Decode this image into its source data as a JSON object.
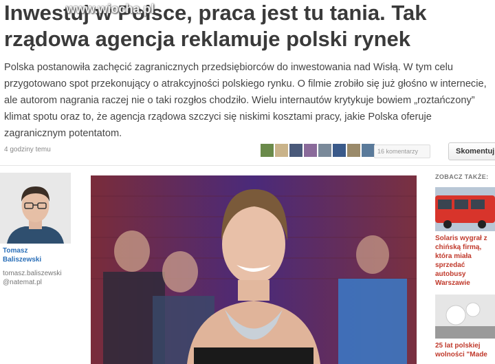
{
  "article": {
    "title_line1": "Inwestuj w Polsce, praca jest tu tania. Tak",
    "title_line2": "rządowa agencja reklamuje polski rynek",
    "watermark": "www.wiocha.pl",
    "lead": "Polska postanowiła zachęcić zagranicznych przedsiębiorców do inwestowania nad Wisłą. W tym celu przygotowano spot przekonujący o atrakcyjności polskiego rynku. O filmie zrobiło się już głośno w internecie, ale autorom nagrania raczej nie o taki rozgłos chodziło. Wielu internautów krytykuje bowiem „roztańczony” klimat spotu oraz to, że agencja rządowa szczyci się niskimi kosztami pracy, jakie Polska oferuje zagranicznym potentatom.",
    "timestamp": "4 godziny temu",
    "comments": "16 komentarzy",
    "comment_button": "Skomentuj"
  },
  "author": {
    "name_line1": "Tomasz",
    "name_line2": "Baliszewski",
    "handle_line1": "tomasz.baliszewski",
    "handle_line2": "@natemat.pl"
  },
  "sidebar": {
    "heading": "ZOBACZ TAKŻE:",
    "items": [
      {
        "title": "Solaris wygrał z chińską firmą, która miała sprzedać autobusy Warszawie"
      },
      {
        "title": "25 lat polskiej wolności \"Made"
      }
    ]
  },
  "colors": {
    "author_link": "#2a6fb8",
    "sidebar_link": "#c0392b",
    "headline": "#3a3a3a"
  }
}
